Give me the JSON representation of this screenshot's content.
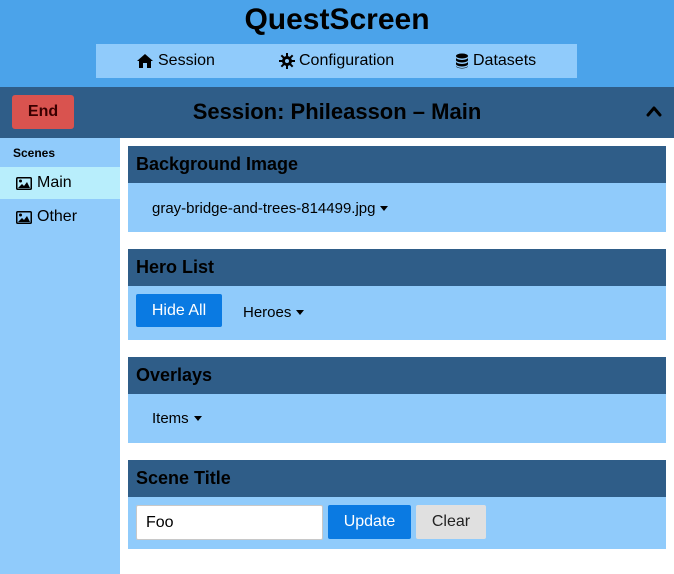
{
  "app": {
    "title": "QuestScreen"
  },
  "nav": {
    "session_label": "Session",
    "configuration_label": "Configuration",
    "datasets_label": "Datasets"
  },
  "session_bar": {
    "end_label": "End",
    "title": "Session: Phileasson – Main"
  },
  "sidebar": {
    "heading": "Scenes",
    "items": [
      {
        "label": "Main",
        "active": true
      },
      {
        "label": "Other",
        "active": false
      }
    ]
  },
  "panels": {
    "background": {
      "title": "Background Image",
      "selected_file": "gray-bridge-and-trees-814499.jpg"
    },
    "heroes": {
      "title": "Hero List",
      "hide_all_label": "Hide All",
      "dropdown_label": "Heroes"
    },
    "overlays": {
      "title": "Overlays",
      "dropdown_label": "Items"
    },
    "scene_title": {
      "title": "Scene Title",
      "input_value": "Foo",
      "update_label": "Update",
      "clear_label": "Clear"
    }
  },
  "colors": {
    "header_bg": "#4ba3ea",
    "nav_bg": "#90cbfb",
    "bar_dark": "#2f5d88",
    "danger": "#d9534f",
    "primary": "#0a7ae2",
    "sidebar_active": "#b8eefc"
  },
  "icons": {
    "session": "home-icon",
    "configuration": "gear-icon",
    "datasets": "database-icon",
    "scene": "image-icon",
    "collapse": "chevron-up-icon"
  }
}
